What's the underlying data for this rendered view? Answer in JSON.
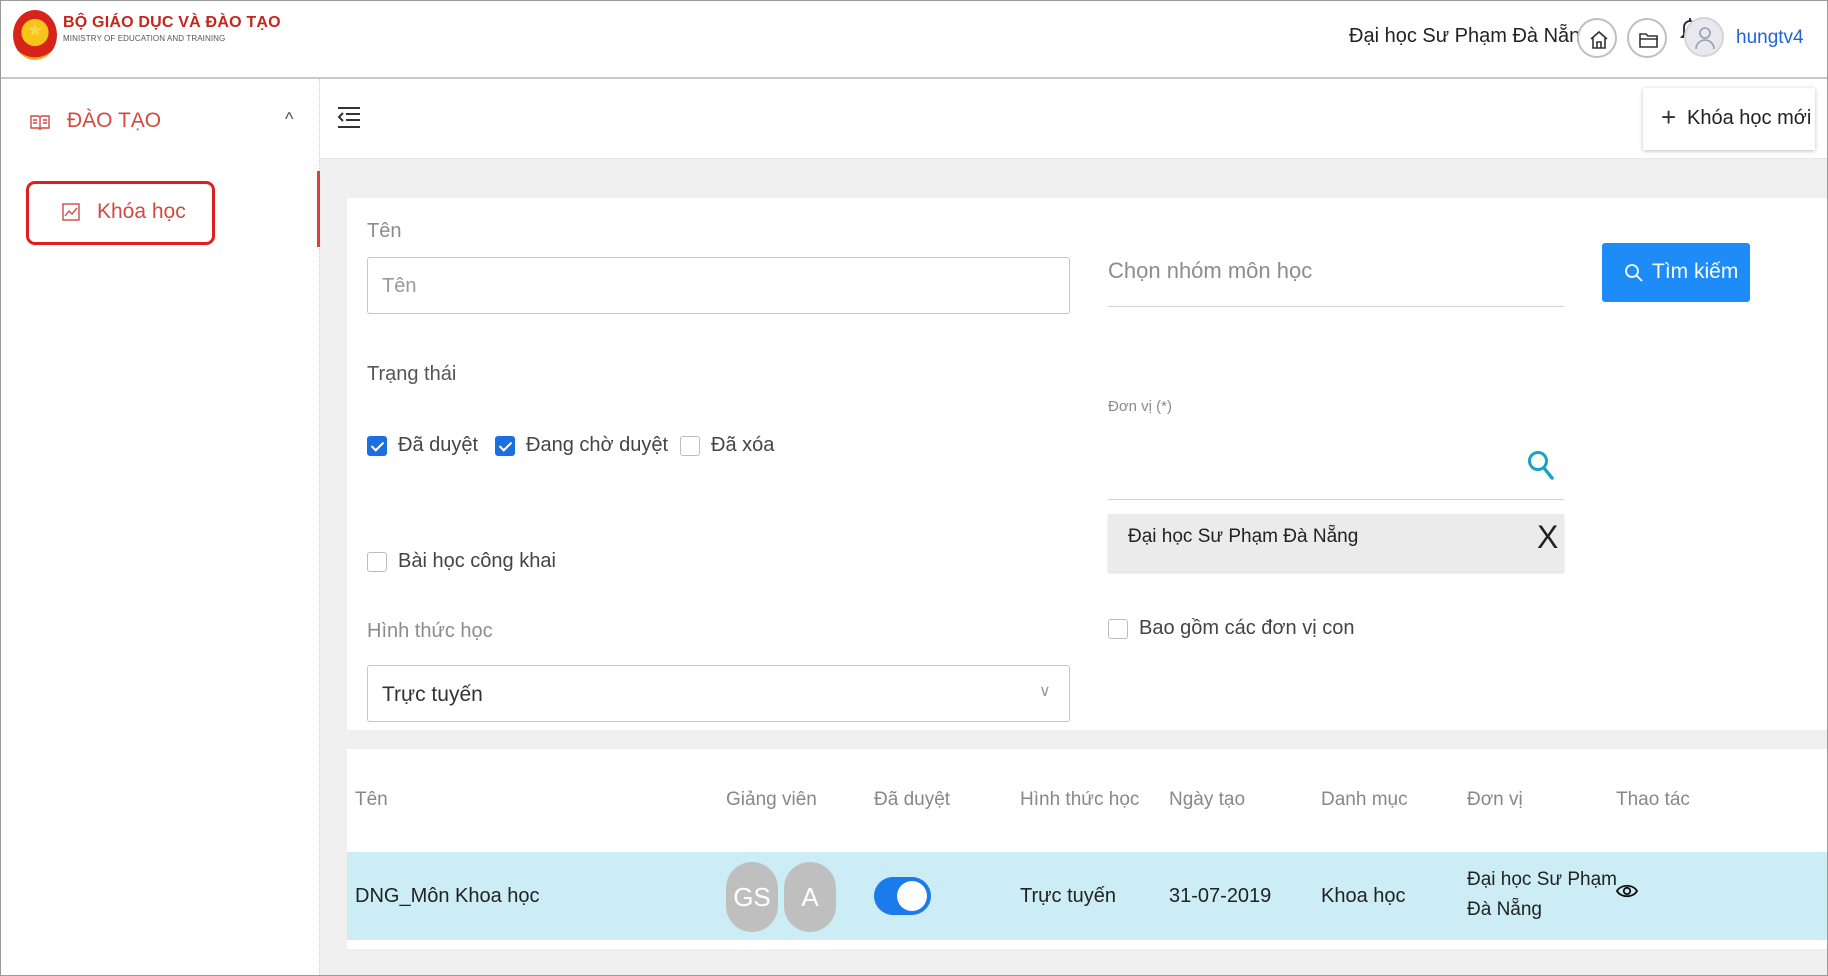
{
  "header": {
    "org_name": "BỘ GIÁO DỤC VÀ ĐÀO TẠO",
    "org_subtitle": "MINISTRY OF EDUCATION AND TRAINING",
    "university": "Đại học Sư Phạm Đà Nẵng",
    "username": "hungtv4"
  },
  "sidebar": {
    "section_label": "ĐÀO TẠO",
    "caret": "^",
    "items": [
      {
        "label": "Khóa học",
        "active": true
      }
    ]
  },
  "toolbar": {
    "new_course_plus": "+",
    "new_course_label": "Khóa học mới"
  },
  "filters": {
    "name_label": "Tên",
    "name_placeholder": "Tên",
    "subject_group_placeholder": "Chọn nhóm môn học",
    "search_label": "Tìm kiếm",
    "status_label": "Trạng thái",
    "status_options": [
      {
        "label": "Đã duyệt",
        "checked": true
      },
      {
        "label": "Đang chờ duyệt",
        "checked": true
      },
      {
        "label": "Đã xóa",
        "checked": false
      }
    ],
    "unit_label": "Đơn vị (*)",
    "unit_selected": "Đại học Sư Phạm Đà Nẵng",
    "unit_remove": "X",
    "public_lesson_label": "Bài học công khai",
    "include_sub_units_label": "Bao gồm các đơn vị con",
    "learning_mode_label": "Hình thức học",
    "learning_mode_value": "Trực tuyến",
    "dropdown_chevron": "∨"
  },
  "table": {
    "columns": [
      "Tên",
      "Giảng viên",
      "Đã duyệt",
      "Hình thức học",
      "Ngày tạo",
      "Danh mục",
      "Đơn vị",
      "Thao tác"
    ],
    "rows": [
      {
        "name": "DNG_Môn Khoa học",
        "lecturers": [
          "GS",
          "A"
        ],
        "approved": true,
        "mode": "Trực tuyến",
        "created": "31-07-2019",
        "category": "Khoa học",
        "unit_line1": "Đại học Sư Phạm",
        "unit_line2": "Đà Nẵng"
      }
    ]
  },
  "colors": {
    "accent_red": "#d24a41",
    "primary_blue": "#1d8cf8",
    "row_highlight": "#ccedf5"
  }
}
